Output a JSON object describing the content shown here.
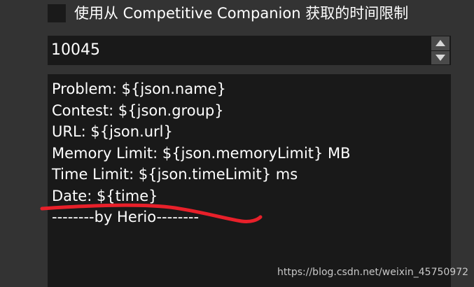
{
  "checkbox": {
    "label": "使用从 Competitive Companion 获取的时间限制",
    "checked": false
  },
  "spinbox": {
    "value": "10045",
    "up_icon": "triangle-up",
    "down_icon": "triangle-down"
  },
  "template": {
    "lines": [
      "Problem: ${json.name}",
      "Contest: ${json.group}",
      "URL: ${json.url}",
      "Memory Limit: ${json.memoryLimit} MB",
      "Time Limit: ${json.timeLimit} ms",
      "Date: ${time}",
      "--------by Herio--------"
    ]
  },
  "watermark": {
    "text": "https://blog.csdn.net/weixin_45750972"
  },
  "colors": {
    "background": "#333333",
    "field_background": "#191919",
    "annotation_red": "#e8202a"
  }
}
